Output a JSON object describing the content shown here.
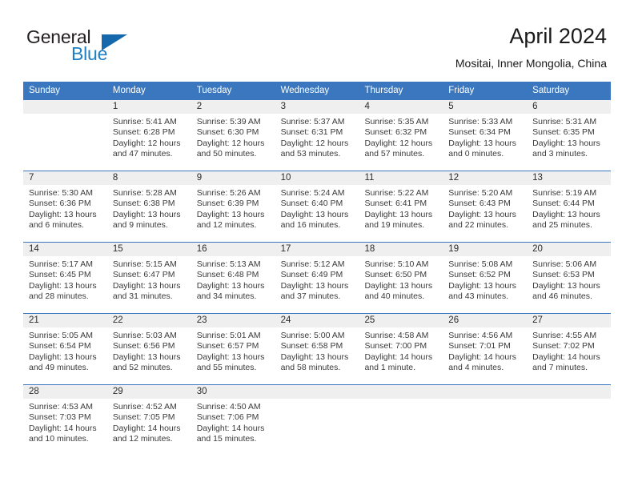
{
  "brand": {
    "name_part1": "General",
    "name_part2": "Blue"
  },
  "header": {
    "title": "April 2024",
    "subtitle": "Mositai, Inner Mongolia, China"
  },
  "colors": {
    "header_blue": "#3a77bf",
    "date_band_gray": "#efefef",
    "brand_blue": "#1f7fc4",
    "text_dark": "#1a1a1a"
  },
  "weekdays": [
    "Sunday",
    "Monday",
    "Tuesday",
    "Wednesday",
    "Thursday",
    "Friday",
    "Saturday"
  ],
  "weeks": [
    [
      {
        "date": "",
        "sunrise": "",
        "sunset": "",
        "daylight1": "",
        "daylight2": ""
      },
      {
        "date": "1",
        "sunrise": "Sunrise: 5:41 AM",
        "sunset": "Sunset: 6:28 PM",
        "daylight1": "Daylight: 12 hours",
        "daylight2": "and 47 minutes."
      },
      {
        "date": "2",
        "sunrise": "Sunrise: 5:39 AM",
        "sunset": "Sunset: 6:30 PM",
        "daylight1": "Daylight: 12 hours",
        "daylight2": "and 50 minutes."
      },
      {
        "date": "3",
        "sunrise": "Sunrise: 5:37 AM",
        "sunset": "Sunset: 6:31 PM",
        "daylight1": "Daylight: 12 hours",
        "daylight2": "and 53 minutes."
      },
      {
        "date": "4",
        "sunrise": "Sunrise: 5:35 AM",
        "sunset": "Sunset: 6:32 PM",
        "daylight1": "Daylight: 12 hours",
        "daylight2": "and 57 minutes."
      },
      {
        "date": "5",
        "sunrise": "Sunrise: 5:33 AM",
        "sunset": "Sunset: 6:34 PM",
        "daylight1": "Daylight: 13 hours",
        "daylight2": "and 0 minutes."
      },
      {
        "date": "6",
        "sunrise": "Sunrise: 5:31 AM",
        "sunset": "Sunset: 6:35 PM",
        "daylight1": "Daylight: 13 hours",
        "daylight2": "and 3 minutes."
      }
    ],
    [
      {
        "date": "7",
        "sunrise": "Sunrise: 5:30 AM",
        "sunset": "Sunset: 6:36 PM",
        "daylight1": "Daylight: 13 hours",
        "daylight2": "and 6 minutes."
      },
      {
        "date": "8",
        "sunrise": "Sunrise: 5:28 AM",
        "sunset": "Sunset: 6:38 PM",
        "daylight1": "Daylight: 13 hours",
        "daylight2": "and 9 minutes."
      },
      {
        "date": "9",
        "sunrise": "Sunrise: 5:26 AM",
        "sunset": "Sunset: 6:39 PM",
        "daylight1": "Daylight: 13 hours",
        "daylight2": "and 12 minutes."
      },
      {
        "date": "10",
        "sunrise": "Sunrise: 5:24 AM",
        "sunset": "Sunset: 6:40 PM",
        "daylight1": "Daylight: 13 hours",
        "daylight2": "and 16 minutes."
      },
      {
        "date": "11",
        "sunrise": "Sunrise: 5:22 AM",
        "sunset": "Sunset: 6:41 PM",
        "daylight1": "Daylight: 13 hours",
        "daylight2": "and 19 minutes."
      },
      {
        "date": "12",
        "sunrise": "Sunrise: 5:20 AM",
        "sunset": "Sunset: 6:43 PM",
        "daylight1": "Daylight: 13 hours",
        "daylight2": "and 22 minutes."
      },
      {
        "date": "13",
        "sunrise": "Sunrise: 5:19 AM",
        "sunset": "Sunset: 6:44 PM",
        "daylight1": "Daylight: 13 hours",
        "daylight2": "and 25 minutes."
      }
    ],
    [
      {
        "date": "14",
        "sunrise": "Sunrise: 5:17 AM",
        "sunset": "Sunset: 6:45 PM",
        "daylight1": "Daylight: 13 hours",
        "daylight2": "and 28 minutes."
      },
      {
        "date": "15",
        "sunrise": "Sunrise: 5:15 AM",
        "sunset": "Sunset: 6:47 PM",
        "daylight1": "Daylight: 13 hours",
        "daylight2": "and 31 minutes."
      },
      {
        "date": "16",
        "sunrise": "Sunrise: 5:13 AM",
        "sunset": "Sunset: 6:48 PM",
        "daylight1": "Daylight: 13 hours",
        "daylight2": "and 34 minutes."
      },
      {
        "date": "17",
        "sunrise": "Sunrise: 5:12 AM",
        "sunset": "Sunset: 6:49 PM",
        "daylight1": "Daylight: 13 hours",
        "daylight2": "and 37 minutes."
      },
      {
        "date": "18",
        "sunrise": "Sunrise: 5:10 AM",
        "sunset": "Sunset: 6:50 PM",
        "daylight1": "Daylight: 13 hours",
        "daylight2": "and 40 minutes."
      },
      {
        "date": "19",
        "sunrise": "Sunrise: 5:08 AM",
        "sunset": "Sunset: 6:52 PM",
        "daylight1": "Daylight: 13 hours",
        "daylight2": "and 43 minutes."
      },
      {
        "date": "20",
        "sunrise": "Sunrise: 5:06 AM",
        "sunset": "Sunset: 6:53 PM",
        "daylight1": "Daylight: 13 hours",
        "daylight2": "and 46 minutes."
      }
    ],
    [
      {
        "date": "21",
        "sunrise": "Sunrise: 5:05 AM",
        "sunset": "Sunset: 6:54 PM",
        "daylight1": "Daylight: 13 hours",
        "daylight2": "and 49 minutes."
      },
      {
        "date": "22",
        "sunrise": "Sunrise: 5:03 AM",
        "sunset": "Sunset: 6:56 PM",
        "daylight1": "Daylight: 13 hours",
        "daylight2": "and 52 minutes."
      },
      {
        "date": "23",
        "sunrise": "Sunrise: 5:01 AM",
        "sunset": "Sunset: 6:57 PM",
        "daylight1": "Daylight: 13 hours",
        "daylight2": "and 55 minutes."
      },
      {
        "date": "24",
        "sunrise": "Sunrise: 5:00 AM",
        "sunset": "Sunset: 6:58 PM",
        "daylight1": "Daylight: 13 hours",
        "daylight2": "and 58 minutes."
      },
      {
        "date": "25",
        "sunrise": "Sunrise: 4:58 AM",
        "sunset": "Sunset: 7:00 PM",
        "daylight1": "Daylight: 14 hours",
        "daylight2": "and 1 minute."
      },
      {
        "date": "26",
        "sunrise": "Sunrise: 4:56 AM",
        "sunset": "Sunset: 7:01 PM",
        "daylight1": "Daylight: 14 hours",
        "daylight2": "and 4 minutes."
      },
      {
        "date": "27",
        "sunrise": "Sunrise: 4:55 AM",
        "sunset": "Sunset: 7:02 PM",
        "daylight1": "Daylight: 14 hours",
        "daylight2": "and 7 minutes."
      }
    ],
    [
      {
        "date": "28",
        "sunrise": "Sunrise: 4:53 AM",
        "sunset": "Sunset: 7:03 PM",
        "daylight1": "Daylight: 14 hours",
        "daylight2": "and 10 minutes."
      },
      {
        "date": "29",
        "sunrise": "Sunrise: 4:52 AM",
        "sunset": "Sunset: 7:05 PM",
        "daylight1": "Daylight: 14 hours",
        "daylight2": "and 12 minutes."
      },
      {
        "date": "30",
        "sunrise": "Sunrise: 4:50 AM",
        "sunset": "Sunset: 7:06 PM",
        "daylight1": "Daylight: 14 hours",
        "daylight2": "and 15 minutes."
      },
      {
        "date": "",
        "sunrise": "",
        "sunset": "",
        "daylight1": "",
        "daylight2": ""
      },
      {
        "date": "",
        "sunrise": "",
        "sunset": "",
        "daylight1": "",
        "daylight2": ""
      },
      {
        "date": "",
        "sunrise": "",
        "sunset": "",
        "daylight1": "",
        "daylight2": ""
      },
      {
        "date": "",
        "sunrise": "",
        "sunset": "",
        "daylight1": "",
        "daylight2": ""
      }
    ]
  ]
}
